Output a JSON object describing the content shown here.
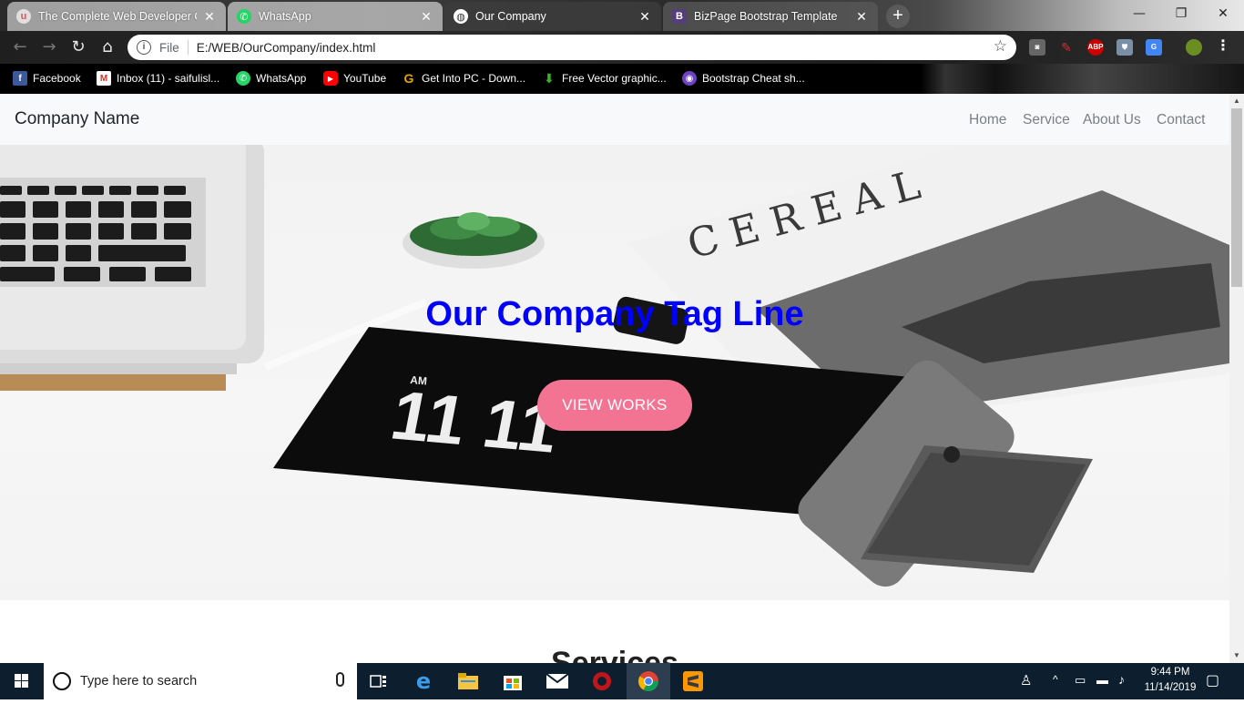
{
  "browser": {
    "tabs": [
      {
        "title": "The Complete Web Developer Co",
        "favicon": "udemy-icon",
        "active": false
      },
      {
        "title": "WhatsApp",
        "favicon": "whatsapp-icon",
        "active": false
      },
      {
        "title": "Our Company",
        "favicon": "globe-icon",
        "active": true
      },
      {
        "title": "BizPage Bootstrap Template",
        "favicon": "bootstrap-icon",
        "active": false
      }
    ],
    "address": {
      "scheme_label": "File",
      "url": "E:/WEB/OurCompany/index.html"
    },
    "bookmarks": [
      {
        "label": "Facebook",
        "icon": "facebook-icon",
        "color": "#3b5998"
      },
      {
        "label": "Inbox (11) - saifulisl...",
        "icon": "gmail-icon",
        "color": "#d93025"
      },
      {
        "label": "WhatsApp",
        "icon": "whatsapp-icon",
        "color": "#25d366"
      },
      {
        "label": "YouTube",
        "icon": "youtube-icon",
        "color": "#ff0000"
      },
      {
        "label": "Get Into PC - Down...",
        "icon": "getintopc-icon",
        "color": "#e0a800"
      },
      {
        "label": "Free Vector graphic...",
        "icon": "download-icon",
        "color": "#3fae29"
      },
      {
        "label": "Bootstrap Cheat sh...",
        "icon": "cheatsheet-icon",
        "color": "#6f42c1"
      }
    ],
    "extensions": {
      "abp_label": "ABP"
    }
  },
  "page": {
    "brand": "Company Name",
    "nav_links": [
      "Home",
      "Service",
      "About Us",
      "Contact"
    ],
    "hero": {
      "tagline": "Our Company Tag Line",
      "button_label": "VIEW WORKS",
      "magazine_title": "CEREAL",
      "clock_ampm": "AM",
      "clock_digits": "11  11"
    },
    "next_section_title": "Services"
  },
  "taskbar": {
    "search_placeholder": "Type here to search",
    "time": "9:44 PM",
    "date": "11/14/2019"
  },
  "colors": {
    "tagline": "#0000ff",
    "button": "#f27392",
    "navbar_bg": "#f8f9fa",
    "taskbar_bg": "#0d1f2f"
  }
}
